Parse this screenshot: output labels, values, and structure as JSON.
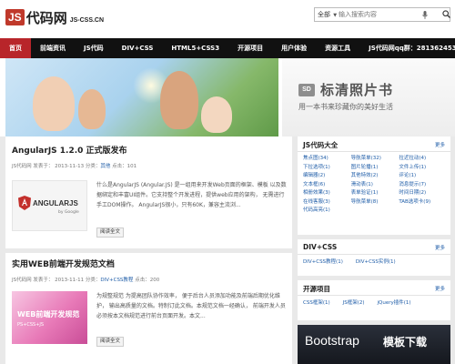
{
  "site": {
    "logo_js": "JS",
    "logo_cn": "代码网",
    "logo_domain": "JS-CSS.CN"
  },
  "search": {
    "scope": "全部",
    "placeholder": "输入搜索内容"
  },
  "nav": {
    "items": [
      "首页",
      "前端资讯",
      "JS代码",
      "DIV+CSS",
      "HTML5+CSS3",
      "开源项目",
      "用户体验",
      "资源工具",
      "JS代码网qq群：281362453"
    ]
  },
  "banner": {
    "badge": "SD",
    "title": "标清照片书",
    "subtitle": "用一本书来珍藏你的美好生活"
  },
  "posts": [
    {
      "title": "AngularJS 1.2.0 正式版发布",
      "author": "JS代码网",
      "date_label": "发表于：",
      "date": "2013-11-13",
      "cat_label": "分类：",
      "category": "其他",
      "views_label": "点击：",
      "views": "101",
      "thumb_text": "ANGULARJS",
      "thumb_by": "by Google",
      "excerpt": "什么是AngularJS (Angular.JS) 是一组用来开发Web页面的框架、模板 以及数据绑定和丰富UI组件。它支持整个开发进程，提供web应用的架构， 无需进行手工DOM操作。 AngularJS很小，只有60K，兼容主流浏...",
      "readmore": "阅读全文"
    },
    {
      "title": "实用WEB前端开发规范文档",
      "author": "JS代码网",
      "date_label": "发表于：",
      "date": "2013-11-11",
      "cat_label": "分类：",
      "category": "DIV+CSS教程",
      "views_label": "点击：",
      "views": "200",
      "thumb_text": "WEB前端开发规范",
      "thumb_sub": "PS+CSS+JS",
      "excerpt": "为规整规范  为提高团队协作效率， 便于后台人员添加功能及前端后期优化维护， 输出高质量的文档。特制订此文档。本规范文档一经确认， 前端开发人员必须按本文档规范进行前台页面开发。本文...",
      "readmore": "阅读全文"
    }
  ],
  "sidebar": {
    "js_widget": {
      "title": "JS代码大全",
      "more": "更多",
      "tags": [
        "焦点图(34)",
        "导航菜单(32)",
        "拉近拉动(4)",
        "下拉选项(1)",
        "图片轮播(1)",
        "文件上传(1)",
        "编辑器(2)",
        "其他特效(2)",
        "评论(1)",
        "文本框(6)",
        "滑动表(1)",
        "消息提示(7)",
        "相册效果(3)",
        "表单验证(1)",
        "时间日期(2)",
        "在线客服(3)",
        "导航菜单(8)",
        "TAB选项卡(9)",
        "代码高亮(1)"
      ]
    },
    "divcss_widget": {
      "title": "DIV+CSS",
      "more": "更多",
      "tags": [
        "DIV+CSS教程(1)",
        "DIV+CSS实例(1)"
      ]
    },
    "opensource_widget": {
      "title": "开源项目",
      "more": "更多",
      "tags": [
        "CSS框架(1)",
        "JS框架(2)",
        "jQuery插件(1)"
      ]
    },
    "ad": {
      "text": "Bootstrap",
      "cn": "模板下载"
    }
  },
  "colors": {
    "nav_bg": "#111111",
    "nav_active": "#b8252a",
    "logo_red": "#c0392b",
    "link_blue": "#1f5da8"
  }
}
